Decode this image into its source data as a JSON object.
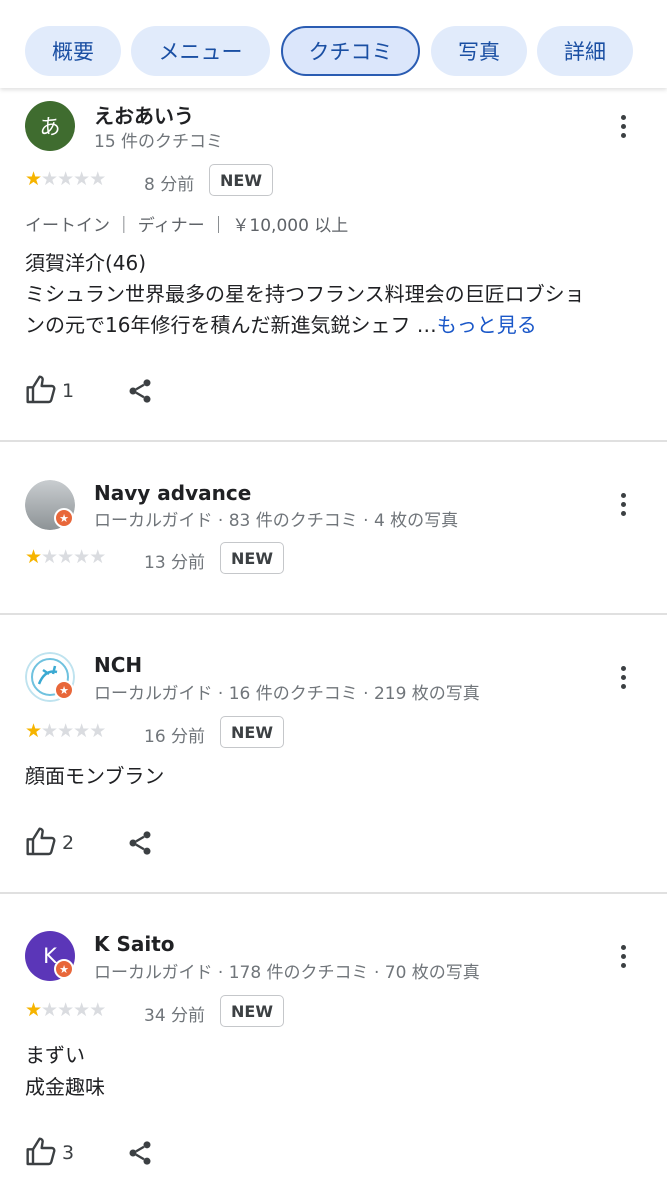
{
  "tabs": [
    "概要",
    "メニュー",
    "クチコミ",
    "写真",
    "詳細"
  ],
  "reviews": [
    {
      "name": "えおあいう",
      "avatar_letter": "あ",
      "avatar_color": "#3f6c2f",
      "meta": "15 件のクチコミ",
      "stars": 1,
      "time": "8 分前",
      "badge": "NEW",
      "attrs": "イートイン ｜ ディナー ｜ ￥10,000 以上",
      "text_lines": [
        "須賀洋介(46)",
        "ミシュラン世界最多の星を持つフランス料理会の巨匠ロブショ",
        "ンの元で16年修行を積んだ新進気鋭シェフ …"
      ],
      "more_link": "もっと見る",
      "likes": "1"
    },
    {
      "name": "Navy advance",
      "meta": "ローカルガイド · 83 件のクチコミ · 4 枚の写真",
      "stars": 1,
      "time": "13 分前",
      "badge": "NEW"
    },
    {
      "name": "NCH",
      "meta": "ローカルガイド · 16 件のクチコミ · 219 枚の写真",
      "stars": 1,
      "time": "16 分前",
      "badge": "NEW",
      "text_lines": [
        "顔面モンブラン"
      ],
      "likes": "2"
    },
    {
      "name": "K Saito",
      "avatar_letter": "K",
      "avatar_color": "#5b36b8",
      "meta": "ローカルガイド · 178 件のクチコミ · 70 枚の写真",
      "stars": 1,
      "time": "34 分前",
      "badge": "NEW",
      "text_lines": [
        "まずい",
        "成金趣味"
      ],
      "likes": "3"
    }
  ],
  "colors": {
    "accent": "#1a57c8",
    "star": "#f6b400",
    "guide_badge": "#e8673a"
  },
  "icons": [
    "thumbs-up-icon",
    "share-icon",
    "more-vert-icon",
    "local-guide-star-icon"
  ]
}
